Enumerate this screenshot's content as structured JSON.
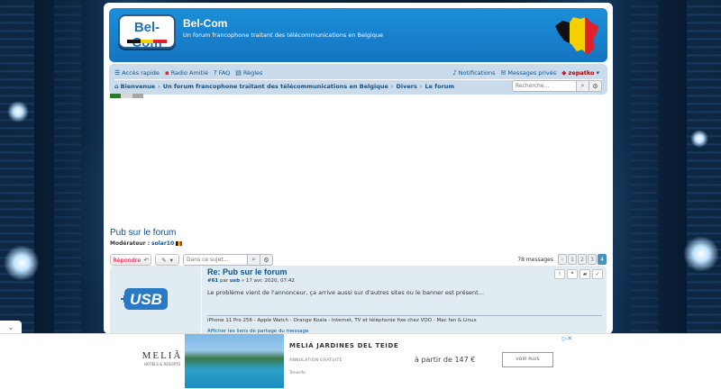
{
  "header": {
    "logo_text": "Bel-Com",
    "site_title": "Bel-Com",
    "site_description": "Un forum francophone traitant des télécommunications en Belgique"
  },
  "nav": {
    "quick_access": "Accès rapide",
    "radio": "Radio Amitié",
    "faq": "FAQ",
    "rules": "Règles",
    "notifications": "Notifications",
    "private_messages": "Messages privés",
    "username": "zepatko"
  },
  "breadcrumb": {
    "home": "Bienvenue",
    "forum": "Un forum francophone traitant des télécommunications en Belgique",
    "section": "Divers",
    "subforum": "Le forum"
  },
  "search": {
    "placeholder": "Recherche…"
  },
  "topic": {
    "title": "Pub sur le forum",
    "moderator_label": "Modérateur :",
    "moderator_name": "solar10"
  },
  "actions": {
    "reply": "Répondre",
    "topic_search_placeholder": "Dans ce sujet…"
  },
  "pagination": {
    "count": "78 messages",
    "pages": [
      "1",
      "2",
      "3",
      "4"
    ],
    "current": "4",
    "prev": "‹"
  },
  "post": {
    "title": "Re: Pub sur le forum",
    "number": "#61",
    "by": "par",
    "author": "usb",
    "date": "» 17 avr. 2020, 07:42",
    "content": "Le problème vient de l'annonceur, ça arrive aussi sur d'autres sites ou le banner est présent…",
    "signature": "iPhone 11 Pro 256 - Apple Watch - Orange Koala - Internet, TV et téléphonie fixe chez VOO - Mac fan & Linux",
    "share": "Afficher les liens de partage du message",
    "avatar_text": "USB"
  },
  "ad": {
    "brand": "MELIÃ",
    "brand_sub": "HOTELS & RESORTS",
    "headline": "MELIÁ JARDINES DEL TEIDE",
    "subline": "ANNULATION GRATUITE",
    "source": "Tenerife",
    "price": "à partir de 147 €",
    "cta": "VOIR PLUS"
  },
  "colors": {
    "header_blue": "#1474c2",
    "link": "#105289",
    "reply_red": "#d31141",
    "nav_bg": "#cadceb",
    "post_bg": "#e1ebf2"
  }
}
